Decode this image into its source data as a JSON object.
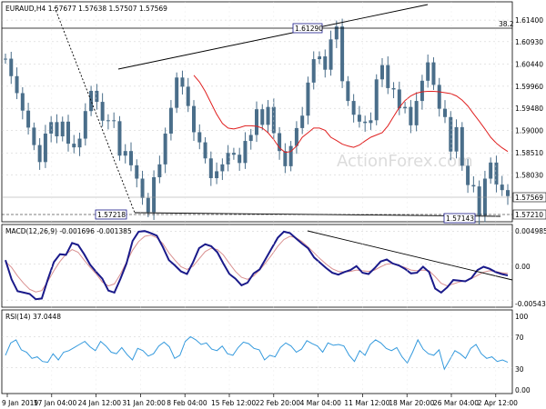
{
  "price_panel": {
    "header": "EURAUD,H4  1.57677 1.57638 1.57507 1.57569",
    "watermark": "ActionForex.com",
    "level_label": "38.2",
    "annotations": {
      "high": "1.61290",
      "low_left": "1.57218",
      "low_right": "1.57143"
    },
    "current_price": "1.57569",
    "support_price": "1.57210"
  },
  "macd_panel": {
    "header": "MACD(12,26,9) -0.001696 -0.001385",
    "axis_labels": [
      "0.004985",
      "0.00",
      "-0.005439"
    ]
  },
  "rsi_panel": {
    "header": "RSI(14) 37.0448",
    "axis_labels": [
      "100",
      "70",
      "30",
      "0.00"
    ]
  },
  "x_axis_labels": [
    "9 Jan 2019",
    "17 Jan 04:00",
    "24 Jan 12:00",
    "31 Jan 20:00",
    "8 Feb 04:00",
    "15 Feb 12:00",
    "22 Feb 20:00",
    "4 Mar 04:00",
    "11 Mar 12:00",
    "18 Mar 20:00",
    "26 Mar 04:00",
    "2 Apr 12:00"
  ],
  "colors": {
    "candle": "#4a6e8a",
    "ma": "#e02020",
    "macd": "#1a1a8a",
    "signal": "#d99090",
    "rsi": "#3399dd",
    "grid": "#c8c8c8",
    "trendline": "#000000",
    "current_box": "#6a6a6a"
  },
  "chart_data": [
    {
      "type": "line",
      "series": [
        {
          "values": [
            1.6056,
            1.6018,
            1.5981,
            1.5943,
            1.5906,
            1.5868,
            1.5831,
            1.5893,
            1.5918,
            1.5887,
            1.5919,
            1.5871,
            1.5863,
            1.5882,
            1.5942,
            1.5986,
            1.5962,
            1.5921,
            1.5922,
            1.592,
            1.5845,
            1.5855,
            1.5824,
            1.5795,
            1.5753,
            1.5722,
            1.5798,
            1.5826,
            1.5893,
            1.5949,
            1.6015,
            1.5995,
            1.5953,
            1.5896,
            1.5874,
            1.5839,
            1.5796,
            1.5811,
            1.5826,
            1.5851,
            1.5847,
            1.5829,
            1.5877,
            1.589,
            1.5946,
            1.5912,
            1.5951,
            1.5894,
            1.5855,
            1.5822,
            1.5866,
            1.5905,
            1.5932,
            1.6004,
            1.6055,
            1.6061,
            1.6032,
            1.6098,
            1.6126,
            1.6007,
            1.5964,
            1.5934,
            1.5919,
            1.5916,
            1.5922,
            1.6011,
            1.6042,
            1.5992,
            1.5989,
            1.5948,
            1.5951,
            1.5911,
            1.5964,
            1.6008,
            1.6048,
            1.5999,
            1.5947,
            1.5929,
            1.5854,
            1.5907,
            1.5823,
            1.5781,
            1.5778,
            1.5715,
            1.5795,
            1.583,
            1.5782,
            1.577,
            1.5757
          ]
        },
        {
          "values": [
            1.602,
            1.6005,
            1.5985,
            1.596,
            1.5935,
            1.5915,
            1.5905,
            1.5903,
            1.5906,
            1.591,
            1.591,
            1.5909,
            1.5905,
            1.5895,
            1.588,
            1.5862,
            1.5852,
            1.5854,
            1.5866,
            1.5885,
            1.5895,
            1.5905,
            1.5905,
            1.59,
            1.5885,
            1.5878,
            1.587,
            1.5866,
            1.5863,
            1.5868,
            1.5877,
            1.5885,
            1.589,
            1.5895,
            1.591,
            1.593,
            1.595,
            1.5965,
            1.5975,
            1.5981,
            1.5984,
            1.5985,
            1.5985,
            1.5984,
            1.5982,
            1.598,
            1.5975,
            1.5966,
            1.5953,
            1.5936,
            1.592,
            1.5903,
            1.5885,
            1.5872,
            1.5862,
            1.5854
          ]
        }
      ],
      "ylim": [
        1.5709,
        1.6156
      ],
      "y_ticks": [
        1.614,
        1.6093,
        1.6044,
        1.5996,
        1.5948,
        1.59,
        1.5851,
        1.5803
      ]
    },
    {
      "type": "line",
      "series": [
        {
          "values": [
            0.0006,
            -0.0023,
            -0.0041,
            -0.0043,
            -0.0045,
            -0.0053,
            -0.0052,
            -0.0023,
            0.0003,
            0.0015,
            0.0014,
            0.0032,
            0.0029,
            0.0015,
            -0.0001,
            -0.0012,
            -0.0022,
            -0.004,
            -0.0043,
            -0.0022,
            0.0001,
            0.0035,
            0.0049,
            0.005,
            0.0047,
            0.0043,
            0.0026,
            0.0006,
            -0.0002,
            -0.0011,
            -0.0015,
            0.0003,
            0.0024,
            0.003,
            0.0027,
            0.0018,
            0.0001,
            -0.0015,
            -0.0022,
            -0.0032,
            -0.0028,
            -0.0014,
            -0.0008,
            0.0008,
            0.0024,
            0.004,
            0.0049,
            0.0047,
            0.0039,
            0.0031,
            0.0024,
            0.001,
            0.0002,
            -0.0006,
            -0.0013,
            -0.0016,
            -0.0012,
            -0.0009,
            -0.0003,
            -0.0013,
            -0.0015,
            -0.0006,
            0.0004,
            0.0007,
            0.0001,
            -0.0002,
            -0.0007,
            -0.0014,
            -0.0013,
            -0.0004,
            -0.0012,
            -0.0037,
            -0.0043,
            -0.0035,
            -0.0024,
            -0.0025,
            -0.0026,
            -0.0021,
            -0.0009,
            -0.0004,
            -0.0007,
            -0.0012,
            -0.0015,
            -0.0017
          ]
        },
        {
          "values": [
            0.0004,
            -0.0005,
            -0.0018,
            -0.0029,
            -0.0038,
            -0.0042,
            -0.004,
            -0.0026,
            -0.001,
            0.0004,
            0.0015,
            0.0022,
            0.0018,
            0.0006,
            -0.0005,
            -0.0015,
            -0.0027,
            -0.0033,
            -0.003,
            -0.0015,
            0.0003,
            0.0021,
            0.0034,
            0.0042,
            0.0044,
            0.004,
            0.0031,
            0.0017,
            0.0006,
            -0.0004,
            -0.0008,
            -0.0003,
            0.0008,
            0.0019,
            0.0024,
            0.0022,
            0.0014,
            0.0001,
            -0.0011,
            -0.002,
            -0.0023,
            -0.0018,
            -0.0009,
            0.0002,
            0.0014,
            0.0027,
            0.0037,
            0.0042,
            0.004,
            0.0034,
            0.0026,
            0.0017,
            0.0008,
            0.0,
            -0.0007,
            -0.0011,
            -0.0012,
            -0.0011,
            -0.0009,
            -0.001,
            -0.0011,
            -0.0009,
            -0.0004,
            0.0,
            0.0001,
            -0.0002,
            -0.0005,
            -0.0009,
            -0.001,
            -0.0009,
            -0.001,
            -0.0019,
            -0.0029,
            -0.0033,
            -0.003,
            -0.0027,
            -0.0025,
            -0.0022,
            -0.0017,
            -0.0012,
            -0.001,
            -0.0011,
            -0.0013,
            -0.0014
          ]
        }
      ],
      "ylim": [
        -0.0061,
        0.0053
      ]
    },
    {
      "type": "line",
      "series": [
        {
          "values": [
            46,
            62,
            66,
            53,
            50,
            42,
            44,
            38,
            37,
            48,
            40,
            50,
            52,
            56,
            60,
            64,
            57,
            52,
            64,
            58,
            50,
            48,
            56,
            47,
            40,
            55,
            52,
            45,
            48,
            58,
            63,
            57,
            42,
            46,
            64,
            70,
            66,
            60,
            62,
            54,
            52,
            58,
            48,
            46,
            56,
            63,
            61,
            55,
            53,
            40,
            46,
            44,
            56,
            62,
            58,
            50,
            54,
            65,
            61,
            58,
            50,
            62,
            59,
            60,
            58,
            46,
            38,
            52,
            46,
            60,
            66,
            62,
            55,
            52,
            56,
            44,
            36,
            50,
            66,
            54,
            48,
            46,
            53,
            28,
            40,
            52,
            48,
            42,
            55,
            60,
            48,
            42,
            44,
            38,
            40,
            37
          ]
        }
      ],
      "ylim": [
        0,
        100
      ]
    }
  ]
}
